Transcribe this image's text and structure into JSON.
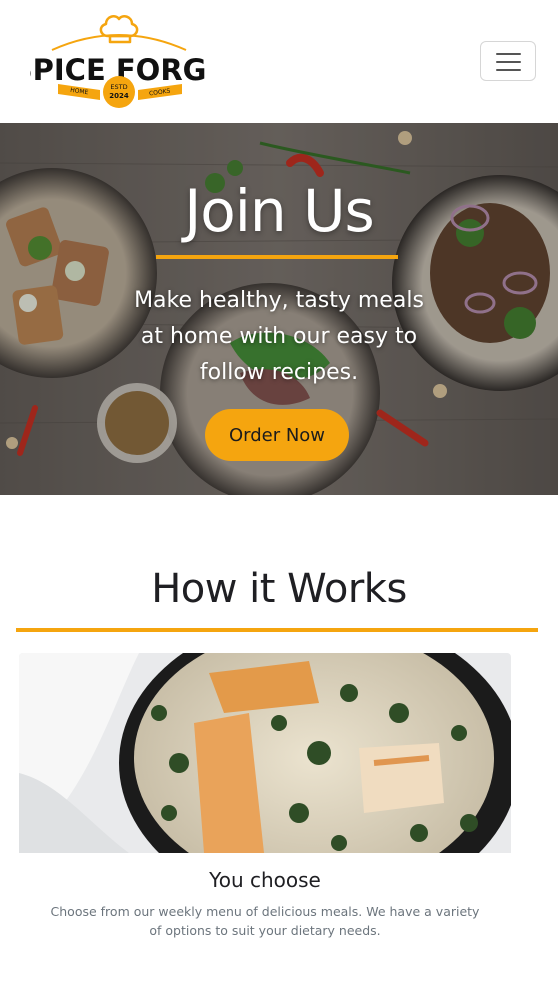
{
  "brand": {
    "name": "SPICE FORGE",
    "ribbon_left": "HOME",
    "ribbon_right": "COOKS",
    "badge_top": "ESTD",
    "badge_year": "2024",
    "accent_color": "#f5a50f"
  },
  "navbar": {
    "menu_icon": "hamburger-menu-icon"
  },
  "hero": {
    "title": "Join Us",
    "text": "Make healthy, tasty meals at home with our easy to follow recipes.",
    "button_label": "Order Now"
  },
  "how_it_works": {
    "title": "How it Works",
    "cards": [
      {
        "title": "You choose",
        "text": "Choose from our weekly menu of delicious meals. We have a variety of options to suit your dietary needs."
      }
    ]
  }
}
